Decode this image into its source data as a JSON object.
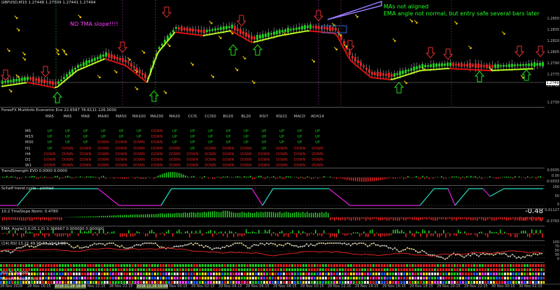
{
  "window": {
    "symbol_title": "GBPUSD,M15  1.27448 1.27509 1.27441 1.27494"
  },
  "annotations": {
    "tma_note": "NO TMA slope!!!!",
    "ma_note_1": "MAs not aligned",
    "ma_note_2": "EMA angle not normal, but entry safe several bars later"
  },
  "price_axis": [
    "1.2850",
    "1.2835",
    "1.2820",
    "1.2805",
    "1.2790",
    "1.2775",
    "1.2760",
    "1.2749",
    "1.2730"
  ],
  "price_current_label": "1.2749",
  "multiinfo": {
    "title": "ForexFX MultiInfo Economic Eco 22.6587 76.6111 126.0000",
    "columns": [
      "MA5",
      "MA5",
      "MA8",
      "MA40",
      "MA50",
      "MA100",
      "MA200",
      "MA20",
      "CCI5",
      "CCI50",
      "BU20",
      "BL20",
      "RSI7",
      "RSI21",
      "MACD",
      "ADX14"
    ],
    "rows": [
      {
        "tf": "M5",
        "vals": [
          "UP",
          "UP",
          "UP",
          "UP",
          "UP",
          "UP",
          "DOWN",
          "UP",
          "UP",
          "UP",
          "UP",
          "UP",
          "UP",
          "UP",
          "UP",
          "UP"
        ]
      },
      {
        "tf": "M15",
        "vals": [
          "UP",
          "UP",
          "UP",
          "UP",
          "UP",
          "UP",
          "DOWN",
          "UP",
          "UP",
          "UP",
          "UP",
          "UP",
          "UP",
          "UP",
          "UP",
          "UP"
        ]
      },
      {
        "tf": "M30",
        "vals": [
          "UP",
          "UP",
          "UP",
          "DOWN",
          "DOWN",
          "DOWN",
          "DOWN",
          "UP",
          "UP",
          "UP",
          "UP",
          "UP",
          "UP",
          "UP",
          "UP",
          "UP"
        ]
      },
      {
        "tf": "H1",
        "vals": [
          "UP",
          "DOWN",
          "DOWN",
          "DOWN",
          "DOWN",
          "DOWN",
          "DOWN",
          "DOWN",
          "UP",
          "DOWN",
          "DOWN",
          "DOWN",
          "UP",
          "DOWN",
          "DOWN",
          "DOWN"
        ]
      },
      {
        "tf": "H4",
        "vals": [
          "DOWN",
          "DOWN",
          "DOWN",
          "DOWN",
          "DOWN",
          "DOWN",
          "DOWN",
          "DOWN",
          "DOWN",
          "DOWN",
          "DOWN",
          "DOWN",
          "DOWN",
          "DOWN",
          "DOWN",
          "DOWN"
        ]
      },
      {
        "tf": "D1",
        "vals": [
          "DOWN",
          "DOWN",
          "DOWN",
          "DOWN",
          "DOWN",
          "DOWN",
          "DOWN",
          "DOWN",
          "DOWN",
          "DOWN",
          "DOWN",
          "DOWN",
          "DOWN",
          "DOWN",
          "DOWN",
          "DOWN"
        ]
      },
      {
        "tf": "W1",
        "vals": [
          "DOWN",
          "DOWN",
          "DOWN",
          "DOWN",
          "DOWN",
          "DOWN",
          "DOWN",
          "DOWN",
          "DOWN",
          "DOWN",
          "DOWN",
          "DOWN",
          "DOWN",
          "DOWN",
          "DOWN",
          "DOWN"
        ]
      }
    ]
  },
  "panes": {
    "trend_strength": {
      "title": "TrendStrength EVO 0.0000 0.0000",
      "axis": [
        "0.0035",
        "0.00",
        "-0.0033"
      ]
    },
    "schaff": {
      "title": "Schaff trend cycle - plotted",
      "axis": [
        "100",
        "75",
        "50",
        "25",
        "0"
      ]
    },
    "tma_slope": {
      "title": "10.2 TmaSlope Norm: 0.4780",
      "axis": [
        "0.01127",
        "0.00",
        "-0.3763"
      ],
      "value": "-0.48",
      "signal": "Sell Only"
    },
    "ema_angle": {
      "title": "EMA_Angle(3,0,05,1,0) 0.366667 0.000000 0.000000"
    },
    "rsi": {
      "title": "(14) RSI 13.21 49.96 11.19 11.10",
      "axis": [
        "100",
        "70",
        "50",
        "30",
        "0"
      ]
    },
    "rsi_tc": {
      "rows": [
        "RSI TC 5:0000",
        "Trend Freeway (5,0,0)"
      ]
    }
  },
  "time_axis": [
    {
      "label": "28 Nov 2018",
      "hl": false
    },
    {
      "label": "28 Nov 16:15",
      "hl": false
    },
    {
      "label": "2018.11.28 18:45",
      "hl": true
    },
    {
      "label": "28 Nov 22:15",
      "hl": false
    },
    {
      "label": "28 Nov 22:15",
      "hl": false
    },
    {
      "label": "2018.11.28 19:00",
      "hl": true
    },
    {
      "label": "29 Nov 00:15",
      "hl": false
    },
    {
      "label": "29 Nov 02:15",
      "hl": false
    },
    {
      "label": "29 Nov 04:15",
      "hl": false
    },
    {
      "label": "29 Nov 06:15",
      "hl": false
    },
    {
      "label": "29 Nov 08:15",
      "hl": false
    },
    {
      "label": "29 Nov 10:15",
      "hl": false
    },
    {
      "label": "29 Nov 12:15",
      "hl": false
    },
    {
      "label": "29 Nov 14:15",
      "hl": false
    },
    {
      "label": "29 Nov 16:15",
      "hl": false
    },
    {
      "label": "29 Nov 18:15",
      "hl": false
    },
    {
      "label": "29 Nov 20:15",
      "hl": false
    },
    {
      "label": "29 Nov 22:15",
      "hl": false
    },
    {
      "label": "30 Nov 00:15",
      "hl": false
    },
    {
      "label": "30 Nov 02:15",
      "hl": false
    }
  ],
  "colors": {
    "bull_candle": "#1ec81e",
    "bear_candle": "#e02020",
    "tma_up": "#b8ff20",
    "tma_down": "#e01010",
    "arrow_up": "#20e020",
    "arrow_down": "#e03030",
    "note_magenta": "#ff40ff",
    "note_green": "#20ff20"
  }
}
